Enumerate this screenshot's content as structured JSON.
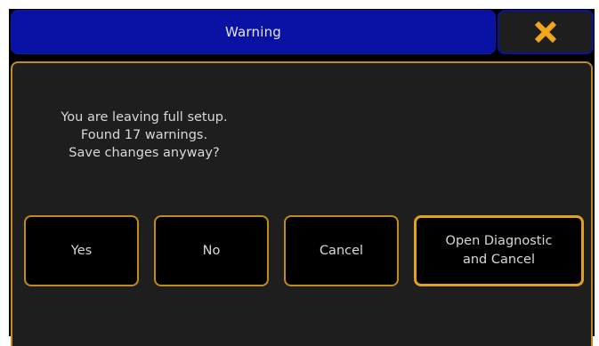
{
  "dialog": {
    "title": "Warning",
    "close_icon": "close-icon",
    "message_lines": [
      "You are leaving full setup.",
      "Found 17 warnings.",
      "Save changes anyway?"
    ],
    "buttons": {
      "yes": "Yes",
      "no": "No",
      "cancel": "Cancel",
      "open_diagnostic_line1": "Open Diagnostic",
      "open_diagnostic_line2": "and Cancel"
    }
  },
  "colors": {
    "title_bar": "#0a11a5",
    "accent_border": "#c08a1e",
    "close_x": "#f2a71b",
    "panel_bg": "#1e1e1e"
  }
}
